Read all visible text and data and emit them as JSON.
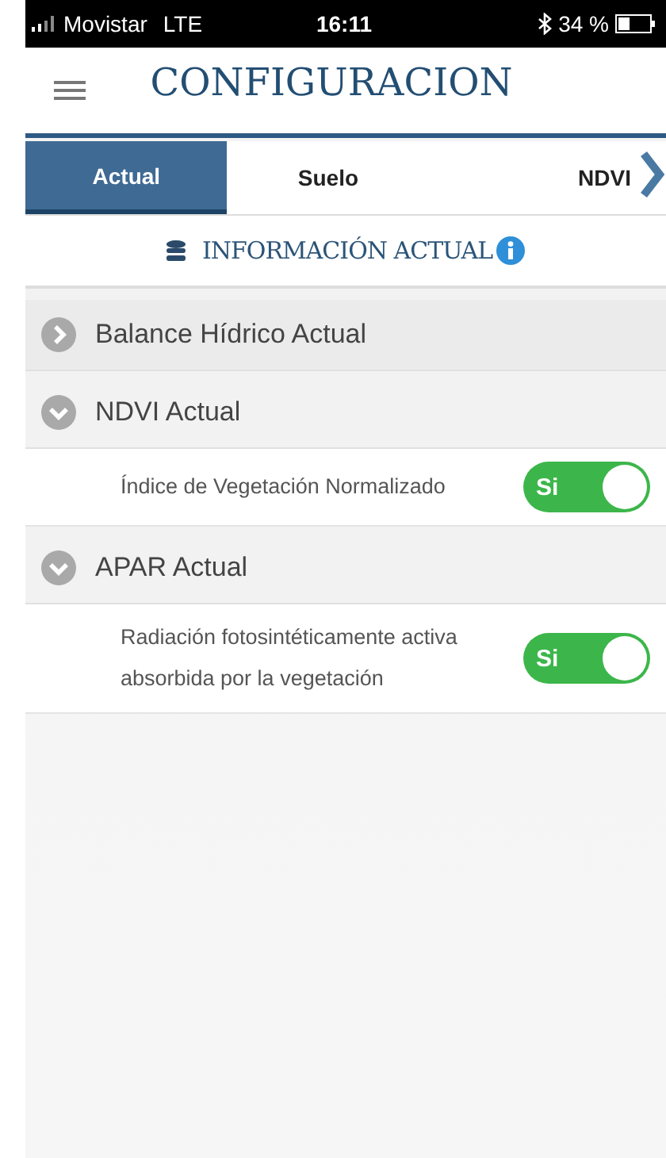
{
  "status_bar": {
    "carrier": "Movistar",
    "network": "LTE",
    "time": "16:11",
    "battery": "34 %"
  },
  "header": {
    "title": "CONFIGURACION"
  },
  "tabs": [
    {
      "label": "Actual",
      "selected": true
    },
    {
      "label": "Suelo",
      "selected": false
    },
    {
      "label": "NDVI",
      "selected": false
    }
  ],
  "info": {
    "title": "INFORMACIÓN ACTUAL"
  },
  "sections": [
    {
      "title": "Balance Hídrico Actual",
      "expanded": false
    },
    {
      "title": "NDVI Actual",
      "expanded": true,
      "settings": [
        {
          "label": "Índice de Vegetación Normalizado",
          "on": true,
          "on_text": "Si"
        }
      ]
    },
    {
      "title": "APAR Actual",
      "expanded": true,
      "settings": [
        {
          "label": "Radiación fotosintéticamente activa absorbida por la vegetación",
          "on": true,
          "on_text": "Si"
        }
      ]
    }
  ]
}
